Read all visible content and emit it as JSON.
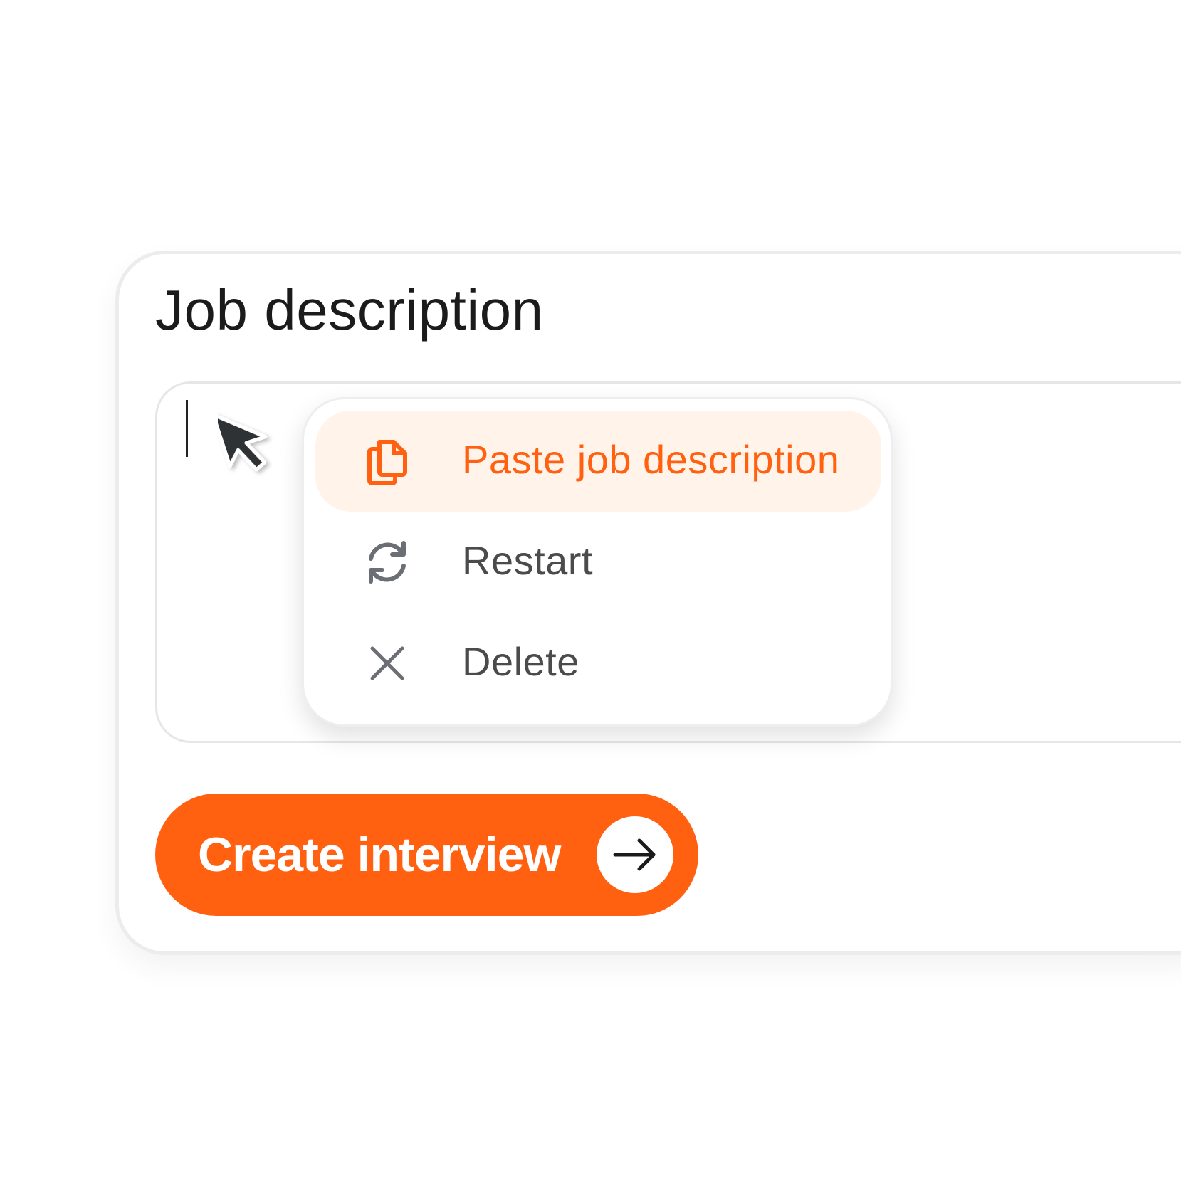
{
  "card": {
    "title": "Job description"
  },
  "editor": {
    "value": ""
  },
  "context_menu": {
    "items": [
      {
        "label": "Paste job description",
        "icon": "paste-document-icon",
        "active": true
      },
      {
        "label": "Restart",
        "icon": "refresh-icon",
        "active": false
      },
      {
        "label": "Delete",
        "icon": "close-icon",
        "active": false
      }
    ]
  },
  "actions": {
    "create_label": "Create interview",
    "create_icon": "arrow-right-icon"
  },
  "colors": {
    "accent": "#ff6111",
    "accent_soft": "#fff3ea",
    "text_dark": "#1b1b1b",
    "text_muted": "#4b4b4b",
    "icon_gray": "#6b6e74",
    "border": "#e6e6e6"
  }
}
